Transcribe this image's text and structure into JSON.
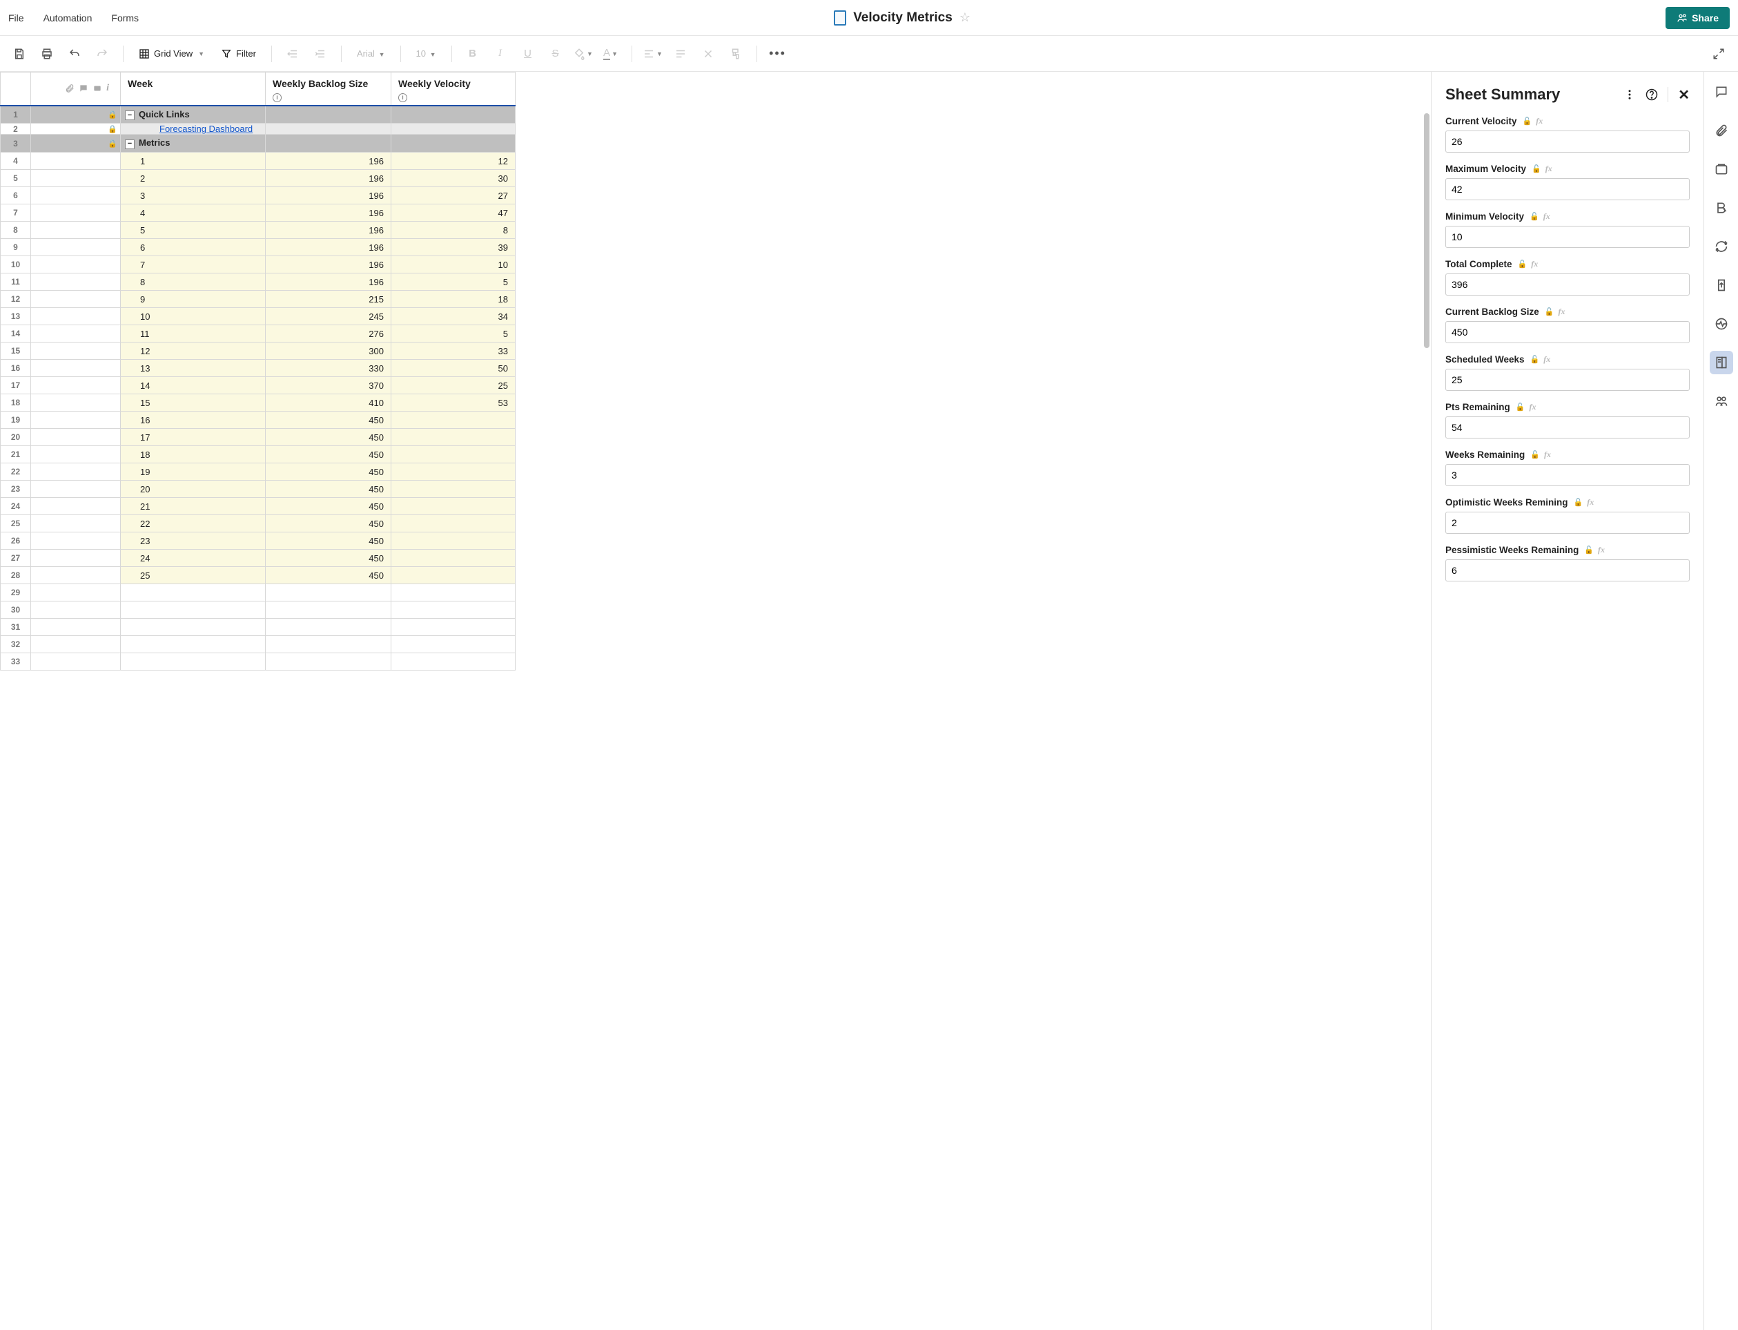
{
  "menu": {
    "file": "File",
    "automation": "Automation",
    "forms": "Forms"
  },
  "doc": {
    "title": "Velocity Metrics"
  },
  "share": {
    "label": "Share"
  },
  "toolbar": {
    "grid_view": "Grid View",
    "filter": "Filter",
    "font": "Arial",
    "font_size": "10"
  },
  "columns": {
    "week": "Week",
    "backlog": "Weekly Backlog Size",
    "velocity": "Weekly Velocity"
  },
  "sections": {
    "quick_links": "Quick Links",
    "metrics": "Metrics",
    "forecasting_link": "Forecasting Dashboard"
  },
  "rows": [
    {
      "n": 4,
      "week": "1",
      "backlog": "196",
      "velocity": "12"
    },
    {
      "n": 5,
      "week": "2",
      "backlog": "196",
      "velocity": "30"
    },
    {
      "n": 6,
      "week": "3",
      "backlog": "196",
      "velocity": "27"
    },
    {
      "n": 7,
      "week": "4",
      "backlog": "196",
      "velocity": "47"
    },
    {
      "n": 8,
      "week": "5",
      "backlog": "196",
      "velocity": "8"
    },
    {
      "n": 9,
      "week": "6",
      "backlog": "196",
      "velocity": "39"
    },
    {
      "n": 10,
      "week": "7",
      "backlog": "196",
      "velocity": "10"
    },
    {
      "n": 11,
      "week": "8",
      "backlog": "196",
      "velocity": "5"
    },
    {
      "n": 12,
      "week": "9",
      "backlog": "215",
      "velocity": "18"
    },
    {
      "n": 13,
      "week": "10",
      "backlog": "245",
      "velocity": "34"
    },
    {
      "n": 14,
      "week": "11",
      "backlog": "276",
      "velocity": "5"
    },
    {
      "n": 15,
      "week": "12",
      "backlog": "300",
      "velocity": "33"
    },
    {
      "n": 16,
      "week": "13",
      "backlog": "330",
      "velocity": "50"
    },
    {
      "n": 17,
      "week": "14",
      "backlog": "370",
      "velocity": "25"
    },
    {
      "n": 18,
      "week": "15",
      "backlog": "410",
      "velocity": "53"
    },
    {
      "n": 19,
      "week": "16",
      "backlog": "450",
      "velocity": ""
    },
    {
      "n": 20,
      "week": "17",
      "backlog": "450",
      "velocity": ""
    },
    {
      "n": 21,
      "week": "18",
      "backlog": "450",
      "velocity": ""
    },
    {
      "n": 22,
      "week": "19",
      "backlog": "450",
      "velocity": ""
    },
    {
      "n": 23,
      "week": "20",
      "backlog": "450",
      "velocity": ""
    },
    {
      "n": 24,
      "week": "21",
      "backlog": "450",
      "velocity": ""
    },
    {
      "n": 25,
      "week": "22",
      "backlog": "450",
      "velocity": ""
    },
    {
      "n": 26,
      "week": "23",
      "backlog": "450",
      "velocity": ""
    },
    {
      "n": 27,
      "week": "24",
      "backlog": "450",
      "velocity": ""
    },
    {
      "n": 28,
      "week": "25",
      "backlog": "450",
      "velocity": ""
    }
  ],
  "empty_rows": [
    29,
    30,
    31,
    32,
    33
  ],
  "summary": {
    "title": "Sheet Summary",
    "fields": [
      {
        "label": "Current Velocity",
        "value": "26"
      },
      {
        "label": "Maximum Velocity",
        "value": "42"
      },
      {
        "label": "Minimum Velocity",
        "value": "10"
      },
      {
        "label": "Total Complete",
        "value": "396"
      },
      {
        "label": "Current Backlog Size",
        "value": "450"
      },
      {
        "label": "Scheduled Weeks",
        "value": "25"
      },
      {
        "label": "Pts Remaining",
        "value": "54"
      },
      {
        "label": "Weeks Remaining",
        "value": "3"
      },
      {
        "label": "Optimistic Weeks Remining",
        "value": "2"
      },
      {
        "label": "Pessimistic Weeks Remaining",
        "value": "6"
      }
    ]
  },
  "row_labels": {
    "r1": "1",
    "r2": "2",
    "r3": "3"
  }
}
